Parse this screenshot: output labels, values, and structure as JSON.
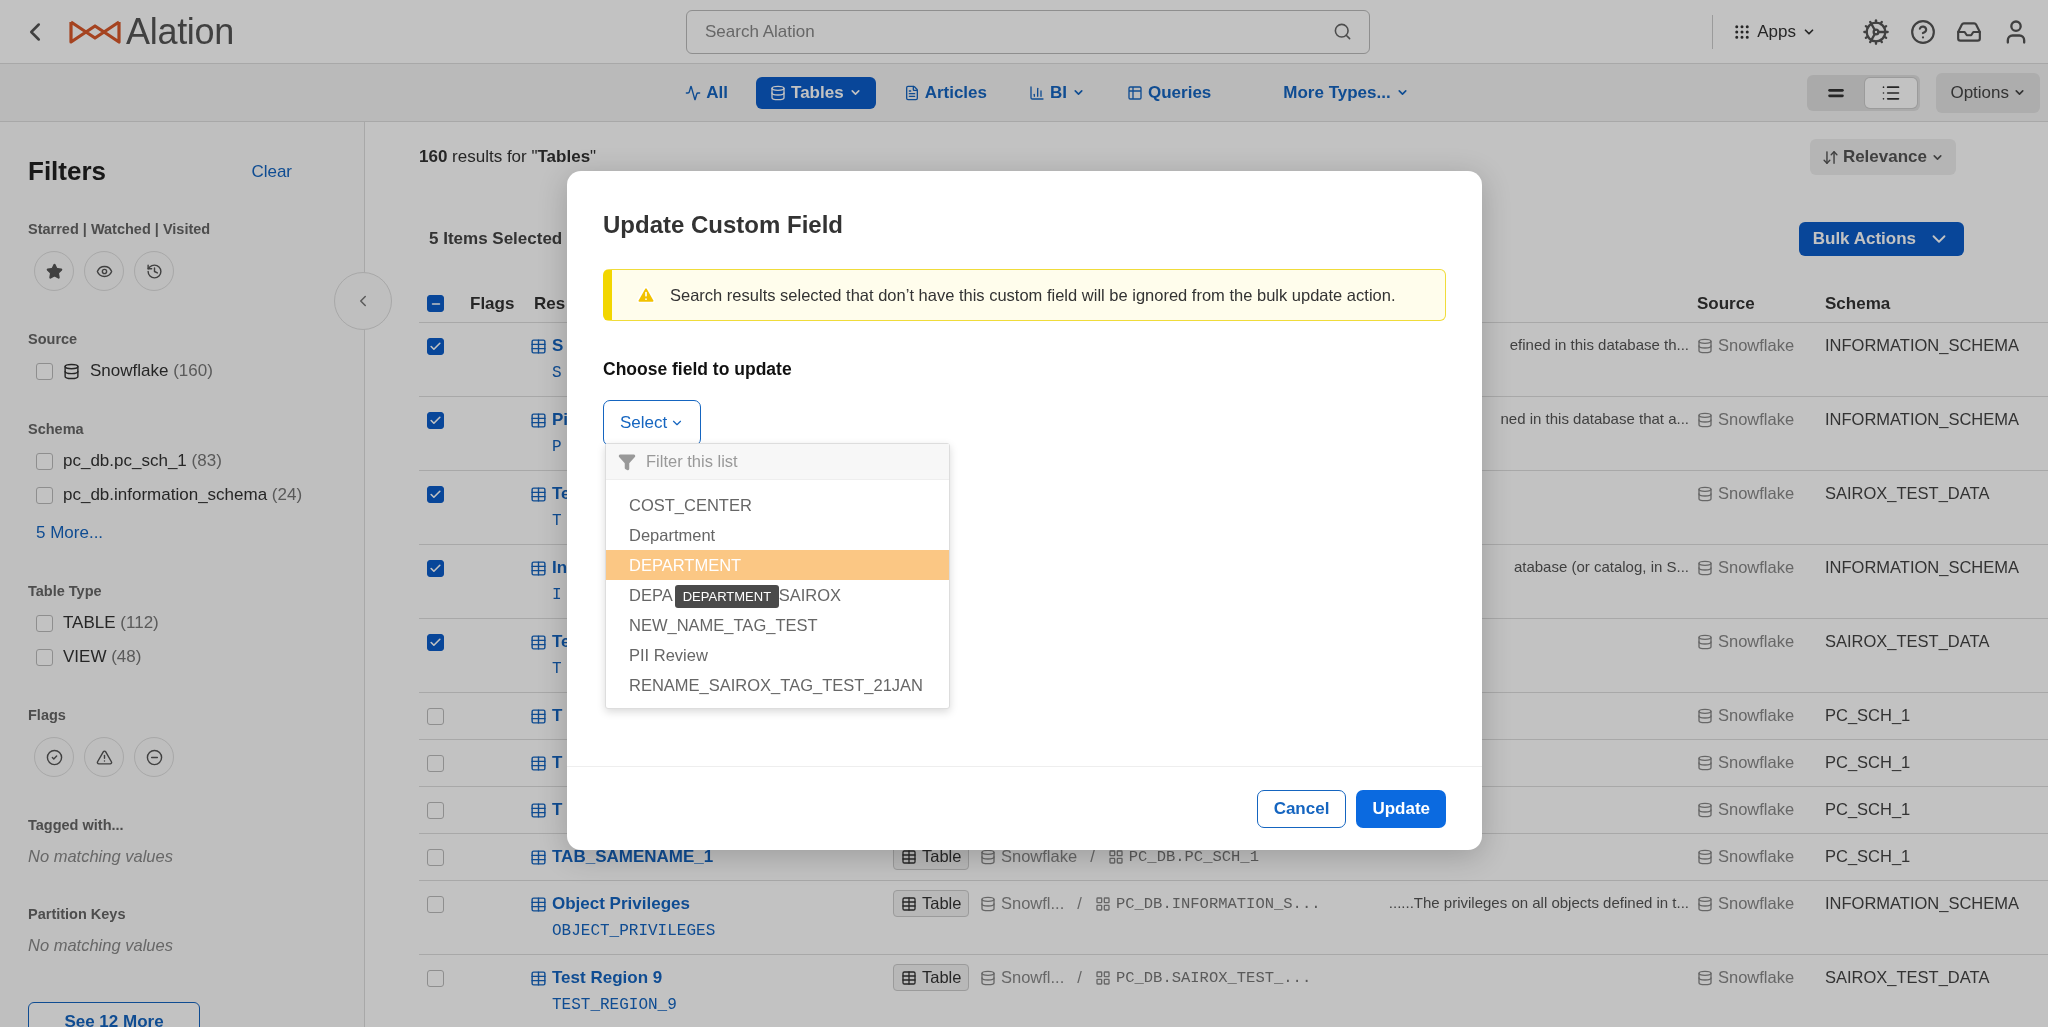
{
  "header": {
    "logo_text": "Alation",
    "search_placeholder": "Search Alation",
    "apps_label": "Apps"
  },
  "type_tabs": [
    {
      "label": "All",
      "selected": false,
      "has_menu": false
    },
    {
      "label": "Tables",
      "selected": true,
      "has_menu": true
    },
    {
      "label": "Articles",
      "selected": false,
      "has_menu": false
    },
    {
      "label": "BI",
      "selected": false,
      "has_menu": true
    },
    {
      "label": "Queries",
      "selected": false,
      "has_menu": false
    },
    {
      "label": "More Types...",
      "selected": false,
      "has_menu": true
    }
  ],
  "view_modes": [
    {
      "selected": false
    },
    {
      "selected": true
    }
  ],
  "options_label": "Options",
  "filters": {
    "title": "Filters",
    "clear_label": "Clear",
    "more_button": "See 12 More",
    "sections": [
      {
        "kind": "bookmarks",
        "title": "Starred | Watched | Visited"
      },
      {
        "kind": "checkboxes",
        "title": "Source",
        "items": [
          {
            "kind": "source",
            "label": "Snowflake",
            "count": "(160)",
            "checked": false
          }
        ]
      },
      {
        "kind": "checkboxes",
        "title": "Schema",
        "more_link": "5 More...",
        "items": [
          {
            "kind": "plain",
            "label": "pc_db.pc_sch_1",
            "count": "(83)",
            "checked": false
          },
          {
            "kind": "plain",
            "label": "pc_db.information_schema",
            "count": "(24)",
            "checked": false
          }
        ]
      },
      {
        "kind": "checkboxes",
        "title": "Table Type",
        "items": [
          {
            "kind": "plain",
            "label": "TABLE",
            "count": "(112)",
            "checked": false
          },
          {
            "kind": "plain",
            "label": "VIEW",
            "count": "(48)",
            "checked": false
          }
        ]
      },
      {
        "kind": "flags",
        "title": "Flags"
      },
      {
        "kind": "empty",
        "title": "Tagged with...",
        "note": "No matching values"
      },
      {
        "kind": "empty",
        "title": "Partition Keys",
        "note": "No matching values"
      }
    ]
  },
  "results": {
    "summary": "**160** results for \"**Tables**\"",
    "sort_label": "Relevance",
    "selection_label": "5 Items Selected",
    "bulk_label": "Bulk Actions",
    "select_all_partial": true,
    "columns": [
      "Flags",
      "Res",
      "Source",
      "Schema"
    ],
    "rows": [
      {
        "checked": true,
        "title": "S",
        "name": "S",
        "description": "efined in this database th...",
        "source": "Snowflake",
        "schema": "INFORMATION_SCHEMA"
      },
      {
        "checked": true,
        "title": "Pi",
        "name": "P",
        "description": "ned in this database that a...",
        "source": "Snowflake",
        "schema": "INFORMATION_SCHEMA"
      },
      {
        "checked": true,
        "title": "Te",
        "name": "T",
        "source": "Snowflake",
        "schema": "SAIROX_TEST_DATA"
      },
      {
        "checked": true,
        "title": "In",
        "name": "I",
        "description": "atabase (or catalog, in S...",
        "source": "Snowflake",
        "schema": "INFORMATION_SCHEMA"
      },
      {
        "checked": true,
        "title": "Te",
        "name": "T",
        "source": "Snowflake",
        "schema": "SAIROX_TEST_DATA"
      },
      {
        "checked": false,
        "title": "T",
        "source": "Snowflake",
        "schema": "PC_SCH_1"
      },
      {
        "checked": false,
        "title": "T",
        "source": "Snowflake",
        "schema": "PC_SCH_1"
      },
      {
        "checked": false,
        "title": "T",
        "source": "Snowflake",
        "schema": "PC_SCH_1"
      },
      {
        "checked": false,
        "title": "TAB_SAMENAME_1",
        "type": "Table",
        "path_source": "Snowflake",
        "separator": "/",
        "path_schema": "PC_DB.PC_SCH_1",
        "source": "Snowflake",
        "schema": "PC_SCH_1"
      },
      {
        "checked": false,
        "title": "Object Privileges",
        "name": "OBJECT_PRIVILEGES",
        "type": "Table",
        "path_source": "Snowfl...",
        "separator": "/",
        "path_schema": "PC_DB.INFORMATION_S...",
        "description": "......The privileges on all objects defined in t...",
        "source": "Snowflake",
        "schema": "INFORMATION_SCHEMA"
      },
      {
        "checked": false,
        "title": "Test Region 9",
        "name": "TEST_REGION_9",
        "type": "Table",
        "path_source": "Snowfl...",
        "separator": "/",
        "path_schema": "PC_DB.SAIROX_TEST_...",
        "source": "Snowflake",
        "schema": "SAIROX_TEST_DATA"
      }
    ]
  },
  "modal": {
    "title": "Update Custom Field",
    "warning": "Search results selected that don’t have this custom field will be ignored from the bulk update action.",
    "field_label": "Choose field to update",
    "select_label": "Select",
    "filter_placeholder": "Filter this list",
    "options": [
      {
        "label": "COST_CENTER",
        "selected": false
      },
      {
        "label": "Department",
        "selected": false
      },
      {
        "label": "DEPARTMENT",
        "selected": true
      },
      {
        "label": "DEPA",
        "label_tail": "SAIROX",
        "selected": false
      },
      {
        "label": "NEW_NAME_TAG_TEST",
        "selected": false
      },
      {
        "label": "PII Review",
        "selected": false
      },
      {
        "label": "RENAME_SAIROX_TAG_TEST_21JAN",
        "selected": false
      }
    ],
    "tooltip": "DEPARTMENT",
    "cancel_label": "Cancel",
    "submit_label": "Update"
  }
}
